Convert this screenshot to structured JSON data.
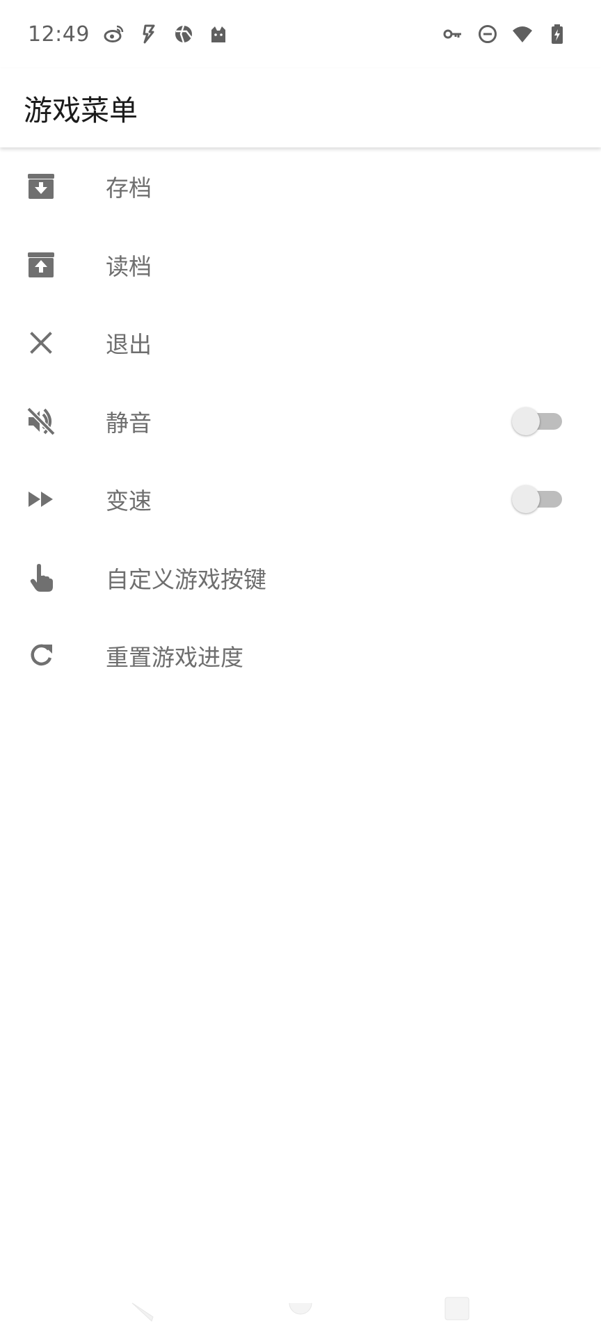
{
  "status_bar": {
    "time": "12:49",
    "left_icons": [
      "weibo-icon",
      "flash-app-icon",
      "aperture-icon",
      "cat-icon"
    ],
    "right_icons": [
      "vpn-key-icon",
      "do-not-disturb-icon",
      "wifi-icon",
      "battery-charging-icon"
    ]
  },
  "app_bar": {
    "title": "游戏菜单"
  },
  "menu": {
    "items": [
      {
        "label": "存档",
        "icon": "archive-download-icon"
      },
      {
        "label": "读档",
        "icon": "archive-upload-icon"
      },
      {
        "label": "退出",
        "icon": "close-icon"
      },
      {
        "label": "静音",
        "icon": "volume-off-icon",
        "toggle": false
      },
      {
        "label": "变速",
        "icon": "fast-forward-icon",
        "toggle": false
      },
      {
        "label": "自定义游戏按键",
        "icon": "touch-hand-icon"
      },
      {
        "label": "重置游戏进度",
        "icon": "refresh-icon"
      }
    ]
  },
  "colors": {
    "icon": "#707070",
    "label": "#6e6e6e",
    "title": "#1b1b1b",
    "toggle_track": "#bdbdbd",
    "toggle_thumb": "#ececec"
  },
  "nav_bar": {
    "buttons": [
      "back-icon",
      "home-icon",
      "recents-icon"
    ]
  }
}
